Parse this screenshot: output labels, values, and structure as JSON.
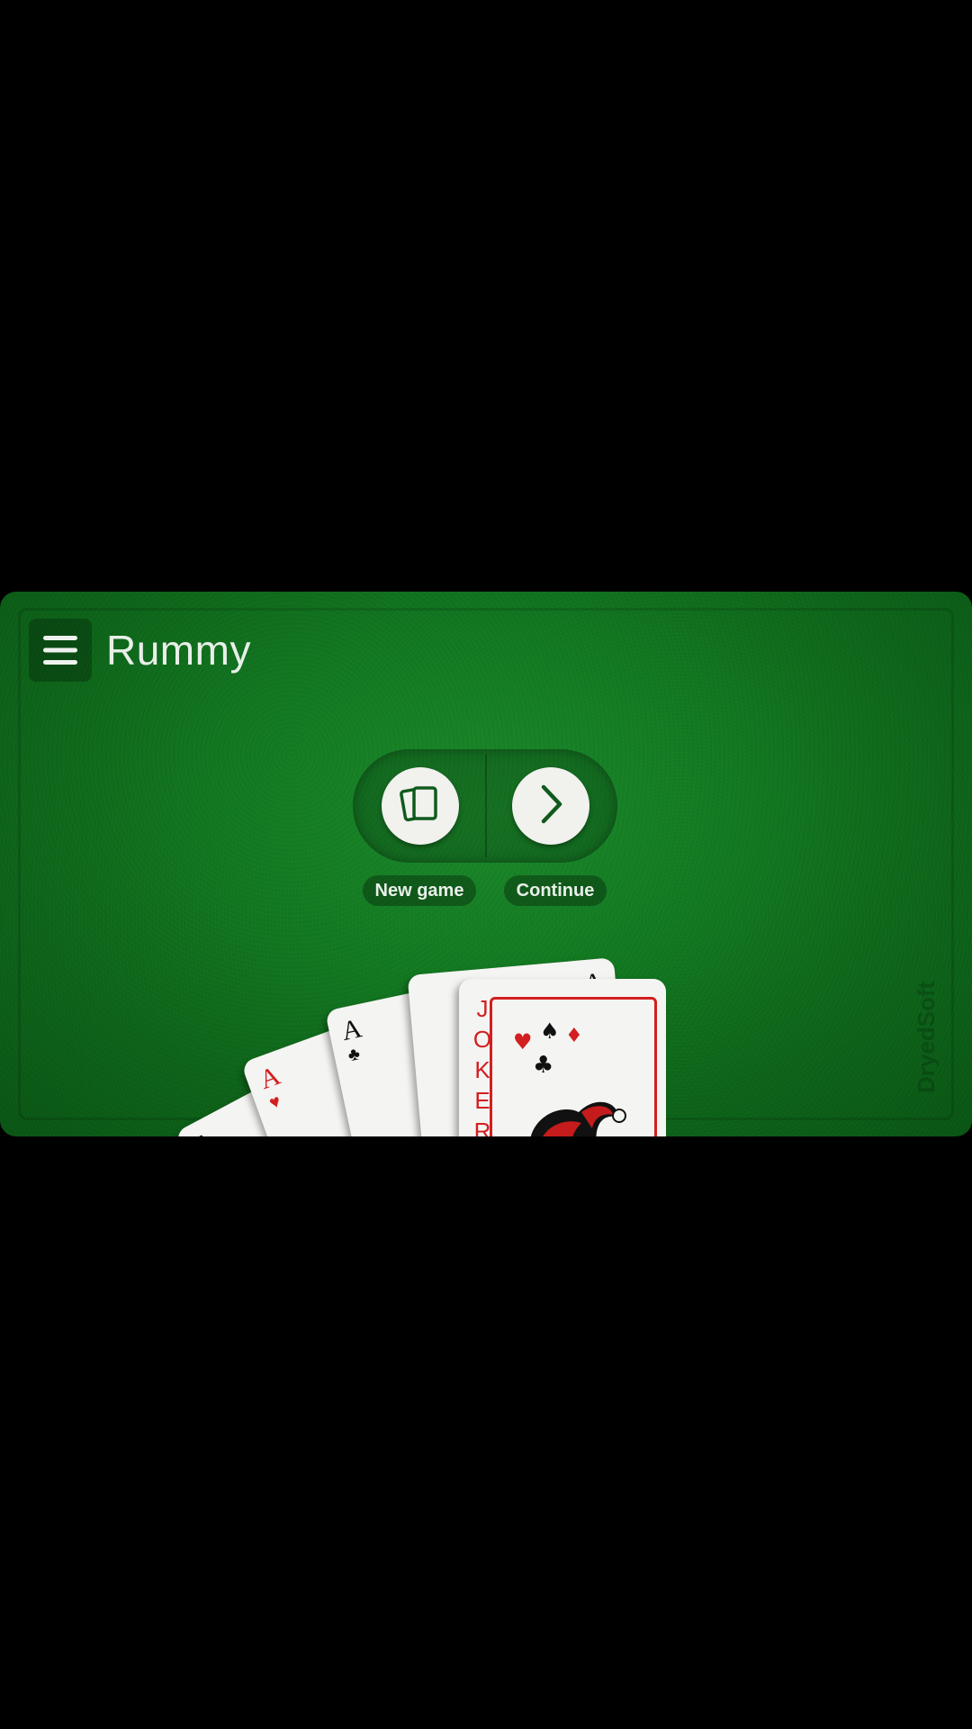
{
  "app": {
    "title": "Rummy"
  },
  "actions": {
    "new_game_label": "New game",
    "continue_label": "Continue"
  },
  "icons": {
    "menu": "hamburger-menu-icon",
    "new_game": "cards-icon",
    "continue": "chevron-right-icon"
  },
  "cards": [
    {
      "rank": "A",
      "suit": "♠",
      "color": "black"
    },
    {
      "rank": "A",
      "suit": "♥",
      "color": "red"
    },
    {
      "rank": "A",
      "suit": "♣",
      "color": "black"
    },
    {
      "rank": "A",
      "suit": "♦",
      "color": "black"
    },
    {
      "rank": "JOKER",
      "suit": "",
      "color": "red"
    }
  ],
  "watermark": "DryedSoft",
  "colors": {
    "felt": "#137a22",
    "button_bg": "#f1f1ee",
    "icon_green": "#0f5a1c",
    "joker_red": "#d21f1f"
  }
}
